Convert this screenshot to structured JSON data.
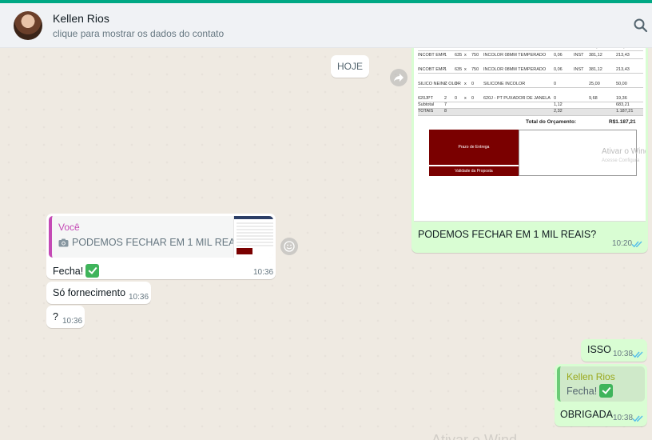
{
  "header": {
    "contact_name": "Kellen Rios",
    "contact_subtitle": "clique para mostrar os dados do contato"
  },
  "chat": {
    "day_label": "HOJE",
    "image_message": {
      "caption": "PODEMOS FECHAR EM 1 MIL REAIS?",
      "time": "10:20",
      "document": {
        "rows": [
          [
            "KITPIA1 50FT",
            "1",
            "0",
            "x",
            "0",
            "KIT PIA 150 X 120 PRETO",
            "0",
            "",
            "187,00",
            "187,00"
          ],
          [
            "INCOBT EMP",
            "1",
            "635",
            "x",
            "750",
            "INCOLOR 08MM TEMPERADO",
            "0,06",
            "INST",
            "381,12",
            "213,43"
          ],
          [
            "INCOBT EMP",
            "1",
            "635",
            "x",
            "750",
            "INCOLOR 08MM TEMPERADO",
            "0,06",
            "INST",
            "381,12",
            "213,43"
          ],
          [
            "SILICO NEINC OLOR",
            "2",
            "0",
            "x",
            "0",
            "SILICONE INCOLOR",
            "0",
            "",
            "25,00",
            "50,00"
          ],
          [
            "620JPT",
            "2",
            "0",
            "x",
            "0",
            "620J - PT PUXADOR DE JANELA",
            "0",
            "",
            "9,68",
            "19,36"
          ],
          [
            "Subtotal",
            "7",
            "",
            "",
            "",
            "",
            "1,12",
            "",
            "",
            "683,21"
          ],
          [
            "TOTAIS",
            "8",
            "",
            "",
            "",
            "",
            "2,32",
            "",
            "",
            "1.187,21"
          ]
        ],
        "total_label": "Total do Orçamento:",
        "total_value": "R$1.187,21",
        "block1_label": "Prazo de Entrega",
        "block2_label": "Validade da Proposta",
        "watermark": "Ativar o Wind",
        "watermark_sub": "Acesse Configura"
      }
    },
    "quoted_message": {
      "author": "Você",
      "quoted_text": "PODEMOS FECHAR EM 1 MIL REAIS?",
      "text": "Fecha!",
      "time": "10:36"
    },
    "messages_in": [
      {
        "text": "Só fornecimento",
        "time": "10:36"
      },
      {
        "text": "?",
        "time": "10:36"
      }
    ],
    "message_out_isso": {
      "text": "ISSO",
      "time": "10:38"
    },
    "reply_message": {
      "author": "Kellen Rios",
      "quoted_text": "Fecha!",
      "text": "OBRIGADA",
      "time": "10:38"
    },
    "bottom_watermark": "Ativar o Wind"
  },
  "colors": {
    "accent": "#00a884",
    "outgoing_bubble": "#d9fdd3",
    "incoming_bubble": "#ffffff",
    "tick_read": "#53bdeb"
  }
}
